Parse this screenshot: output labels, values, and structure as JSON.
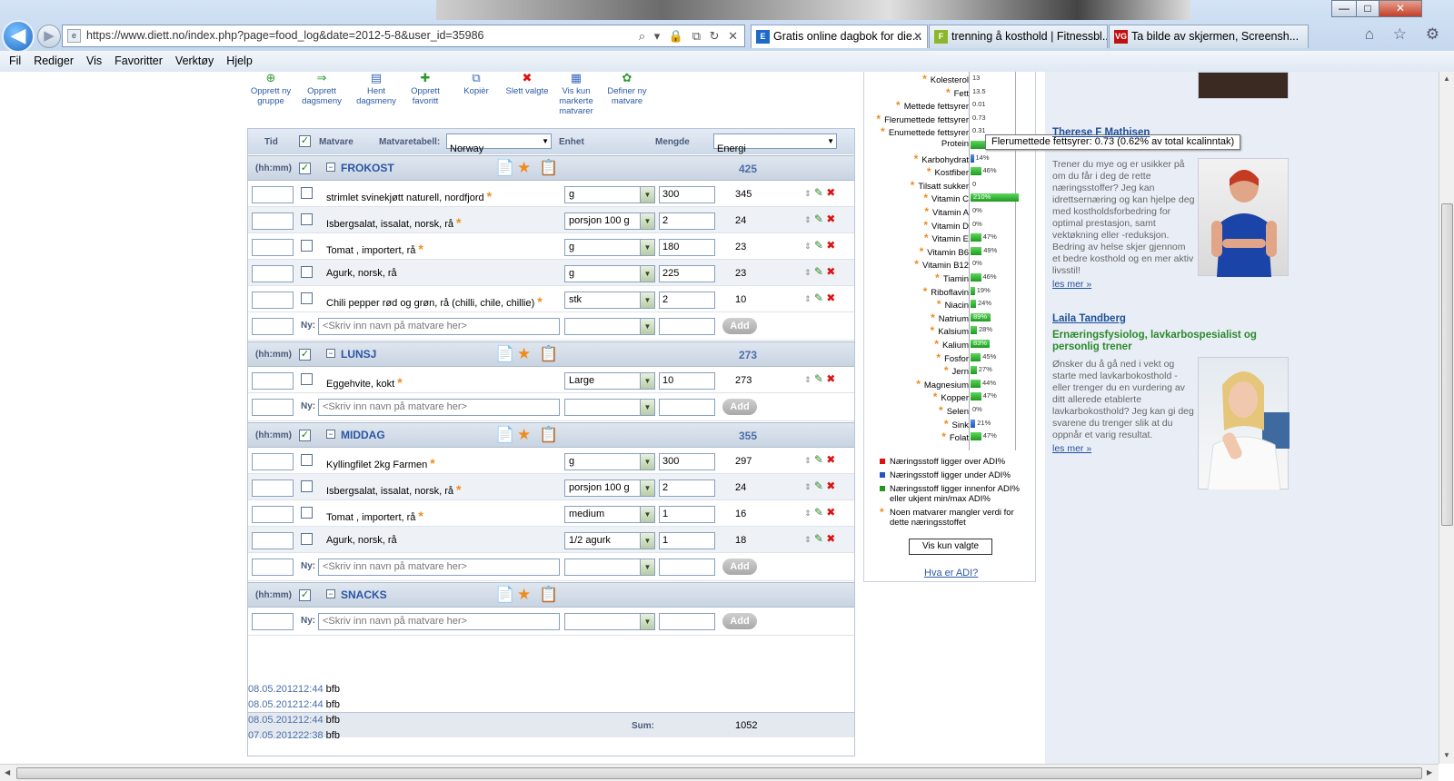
{
  "browser": {
    "url": "https://www.diett.no/index.php?page=food_log&date=2012-5-8&user_id=35986",
    "addr_tools": "⌕ ▾ 🔒 ⧉ ↻ ✕",
    "tabs": [
      {
        "label": "Gratis online dagbok for die...",
        "close": "✕",
        "icon": "E",
        "icon_color": "#1f69c8"
      },
      {
        "label": "trenning å kosthold | Fitnessbl...",
        "close": "",
        "icon": "F",
        "icon_color": "#8ab82a"
      },
      {
        "label": "Ta bilde av skjermen, Screensh...",
        "close": "",
        "icon": "VG",
        "icon_color": "#c01010"
      }
    ],
    "menu": [
      "Fil",
      "Rediger",
      "Vis",
      "Favoritter",
      "Verktøy",
      "Hjelp"
    ]
  },
  "toolbar": [
    {
      "label": "Opprett ny gruppe",
      "icon": "⊕",
      "color": "#2e9a2e"
    },
    {
      "label": "Opprett dagsmeny",
      "icon": "⇒",
      "color": "#2e9a2e"
    },
    {
      "label": "Hent dagsmeny",
      "icon": "▤",
      "color": "#3a6ac0"
    },
    {
      "label": "Opprett favoritt",
      "icon": "✚",
      "color": "#2e9a2e"
    },
    {
      "label": "Kopièr",
      "icon": "⧉",
      "color": "#3a6ac0"
    },
    {
      "label": "Slett valgte",
      "icon": "✖",
      "color": "#d11"
    },
    {
      "label": "Vis kun markerte matvarer",
      "icon": "▦",
      "color": "#3a6ac0"
    },
    {
      "label": "Definer ny matvare",
      "icon": "✿",
      "color": "#2e9a2e"
    }
  ],
  "header": {
    "tid": "Tid",
    "matvare": "Matvare",
    "matvaretabell_label": "Matvaretabell:",
    "matvaretabell_value": "Norway",
    "enhet": "Enhet",
    "mengde": "Mengde",
    "energi_value": "Energi"
  },
  "labels": {
    "hhmm": "(hh:mm)",
    "ny": "Ny:",
    "placeholder": "<Skriv inn navn på matvare her>",
    "add": "Add",
    "sum_label": "Sum:",
    "sum_value": "1052",
    "collapse": "−",
    "check": "✓"
  },
  "meals": [
    {
      "name": "FROKOST",
      "total": "425",
      "items": [
        {
          "name": "strimlet svinekjøtt naturell, nordfjord",
          "star": true,
          "unit": "g",
          "qty": "300",
          "kcal": "345"
        },
        {
          "name": "Isbergsalat, issalat, norsk, rå",
          "star": true,
          "unit": "porsjon 100 g",
          "qty": "2",
          "kcal": "24"
        },
        {
          "name": "Tomat , importert, rå",
          "star": true,
          "unit": "g",
          "qty": "180",
          "kcal": "23"
        },
        {
          "name": "Agurk, norsk, rå",
          "star": false,
          "unit": "g",
          "qty": "225",
          "kcal": "23"
        },
        {
          "name": "Chili pepper rød og grøn, rå (chilli, chile, chillie)",
          "star": true,
          "unit": "stk",
          "qty": "2",
          "kcal": "10"
        }
      ]
    },
    {
      "name": "LUNSJ",
      "total": "273",
      "items": [
        {
          "name": "Eggehvite, kokt",
          "star": true,
          "unit": "Large",
          "qty": "10",
          "kcal": "273"
        }
      ]
    },
    {
      "name": "MIDDAG",
      "total": "355",
      "items": [
        {
          "name": "Kyllingfilet 2kg Farmen",
          "star": true,
          "unit": "g",
          "qty": "300",
          "kcal": "297"
        },
        {
          "name": "Isbergsalat, issalat, norsk, rå",
          "star": true,
          "unit": "porsjon 100 g",
          "qty": "2",
          "kcal": "24"
        },
        {
          "name": "Tomat , importert, rå",
          "star": true,
          "unit": "medium",
          "qty": "1",
          "kcal": "16"
        },
        {
          "name": "Agurk, norsk, rå",
          "star": false,
          "unit": "1/2 agurk",
          "qty": "1",
          "kcal": "18"
        }
      ]
    },
    {
      "name": "SNACKS",
      "total": "",
      "items": []
    }
  ],
  "history": [
    {
      "date": "08.05.201212:44",
      "user": "bfb"
    },
    {
      "date": "08.05.201212:44",
      "user": "bfb"
    },
    {
      "date": "08.05.201212:44",
      "user": "bfb"
    },
    {
      "date": "07.05.201222:38",
      "user": "bfb"
    }
  ],
  "nutrients": [
    {
      "name": "Kolesterol",
      "star": true,
      "pct": 0,
      "label": "13",
      "color": "green"
    },
    {
      "name": "Fett",
      "star": true,
      "pct": 0,
      "label": "13.5",
      "color": "green"
    },
    {
      "name": "Mettede fettsyrer",
      "star": true,
      "pct": 0,
      "label": "0.01",
      "color": "green"
    },
    {
      "name": "Flerumettede fettsyrer",
      "star": true,
      "pct": 0,
      "label": "0.73",
      "color": "green"
    },
    {
      "name": "Enumettede fettsyrer",
      "star": true,
      "pct": 0,
      "label": "0.31",
      "color": "green"
    },
    {
      "name": "Protein",
      "star": false,
      "pct": 100,
      "label": "",
      "color": "green"
    },
    {
      "name": "Karbohydrat",
      "star": true,
      "pct": 14,
      "label": "14%",
      "color": "blue"
    },
    {
      "name": "Kostfiber",
      "star": true,
      "pct": 46,
      "label": "46%",
      "color": "green"
    },
    {
      "name": "Tilsatt sukker",
      "star": true,
      "pct": 0,
      "label": "0",
      "color": "green"
    },
    {
      "name": "Vitamin C",
      "star": true,
      "pct": 210,
      "label": "210%",
      "color": "green"
    },
    {
      "name": "Vitamin A",
      "star": true,
      "pct": 0,
      "label": "0%",
      "color": "green"
    },
    {
      "name": "Vitamin D",
      "star": true,
      "pct": 0,
      "label": "0%",
      "color": "green"
    },
    {
      "name": "Vitamin E",
      "star": true,
      "pct": 47,
      "label": "47%",
      "color": "green"
    },
    {
      "name": "Vitamin B6",
      "star": true,
      "pct": 49,
      "label": "49%",
      "color": "green"
    },
    {
      "name": "Vitamin B12",
      "star": true,
      "pct": 0,
      "label": "0%",
      "color": "green"
    },
    {
      "name": "Tiamin",
      "star": true,
      "pct": 46,
      "label": "46%",
      "color": "green"
    },
    {
      "name": "Riboflavin",
      "star": true,
      "pct": 19,
      "label": "19%",
      "color": "green"
    },
    {
      "name": "Niacin",
      "star": true,
      "pct": 24,
      "label": "24%",
      "color": "green"
    },
    {
      "name": "Natrium",
      "star": true,
      "pct": 89,
      "label": "89%",
      "color": "green"
    },
    {
      "name": "Kalsium",
      "star": true,
      "pct": 28,
      "label": "28%",
      "color": "green"
    },
    {
      "name": "Kalium",
      "star": true,
      "pct": 83,
      "label": "83%",
      "color": "green"
    },
    {
      "name": "Fosfor",
      "star": true,
      "pct": 45,
      "label": "45%",
      "color": "green"
    },
    {
      "name": "Jern",
      "star": true,
      "pct": 27,
      "label": "27%",
      "color": "green"
    },
    {
      "name": "Magnesium",
      "star": true,
      "pct": 44,
      "label": "44%",
      "color": "green"
    },
    {
      "name": "Kopper",
      "star": true,
      "pct": 47,
      "label": "47%",
      "color": "green"
    },
    {
      "name": "Selen",
      "star": true,
      "pct": 0,
      "label": "0%",
      "color": "green"
    },
    {
      "name": "Sink",
      "star": true,
      "pct": 21,
      "label": "21%",
      "color": "blue"
    },
    {
      "name": "Folat",
      "star": true,
      "pct": 47,
      "label": "47%",
      "color": "green"
    }
  ],
  "tooltip": "Flerumettede fettsyrer: 0.73  (0.62% av total kcalinntak)",
  "legend": [
    {
      "color": "#d11",
      "text": "Næringsstoff ligger over ADI%"
    },
    {
      "color": "#1f55c0",
      "text": "Næringsstoff ligger under ADI%"
    },
    {
      "color": "#1f9a1f",
      "text": "Næringsstoff ligger innenfor ADI% eller ukjent min/max ADI%"
    },
    {
      "color": "star",
      "text": "Noen matvarer mangler verdi for dette næringsstoffet"
    }
  ],
  "vis_kun_valgte": "Vis kun valgte",
  "hva_er_adi": "Hva er ADI?",
  "experts": {
    "first_name": "Therese F Mathisen",
    "first_desc": "Trener du mye og er usikker på om du får i deg de rette næringsstoffer? Jeg kan idrettsernæring og kan hjelpe deg med kostholdsforbedring for optimal prestasjon, samt vektøkning eller -reduksjon. Bedring av helse skjer gjennom et bedre kosthold og en mer aktiv livsstil!",
    "more": "les mer »",
    "second_name": "Laila Tandberg",
    "second_title": "Ernæringsfysiolog, lavkarbospesialist og personlig trener",
    "second_desc": "Ønsker du å gå ned i vekt og starte med lavkarbokosthold - eller trenger du en vurdering av ditt allerede etablerte lavkarbokosthold? Jeg kan gi deg svarene du trenger slik at du oppnår et varig resultat."
  },
  "icons": {
    "back": "◀",
    "forward": "▶",
    "win_min": "—",
    "win_max": "□",
    "win_close": "✕",
    "right_icons": "⌂ ☆ ⚙",
    "up_down": "⇕",
    "edit": "✎",
    "delete": "✖",
    "notes": "📄",
    "star": "★",
    "clipboard": "📋",
    "dropdown": "▼"
  },
  "colors": {
    "accent": "#2b56a3",
    "green": "#1f9a1f",
    "blue": "#1f55c0",
    "star": "#f08c1e"
  }
}
